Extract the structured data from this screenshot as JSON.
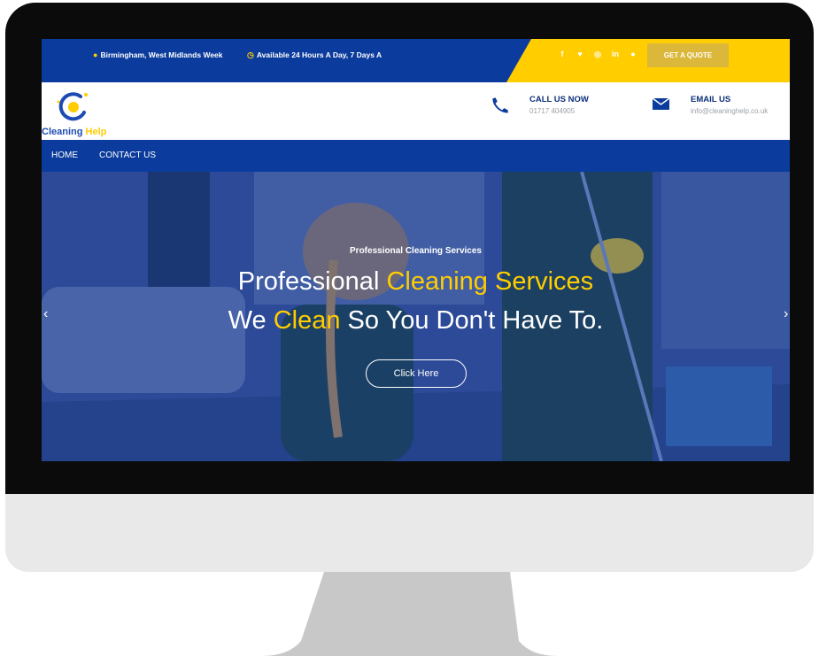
{
  "topbar": {
    "location": "Birmingham, West Midlands Week",
    "availability": "Available 24 Hours A Day, 7 Days A",
    "socials": [
      "f",
      "♥",
      "◎",
      "in",
      "●"
    ],
    "quote_button": "GET A QUOTE"
  },
  "header": {
    "logo_word1": "Cleaning",
    "logo_word2": "Help",
    "call_title": "CALL US NOW",
    "call_number": "01717 404905",
    "email_title": "EMAIL US",
    "email_address": "info@cleaninghelp.co.uk"
  },
  "nav": {
    "items": [
      "HOME",
      "CONTACT US"
    ]
  },
  "hero": {
    "kicker": "Professional Cleaning Services",
    "line1_part1": "Professional",
    "line1_highlight": "Cleaning Services",
    "line2_part1": "We",
    "line2_highlight": "Clean",
    "line2_part2": "So You Don't Have To.",
    "button": "Click Here",
    "arrow_left": "‹",
    "arrow_right": "›"
  },
  "colors": {
    "brand_blue": "#0b3b9c",
    "accent_yellow": "#ffcd00"
  }
}
